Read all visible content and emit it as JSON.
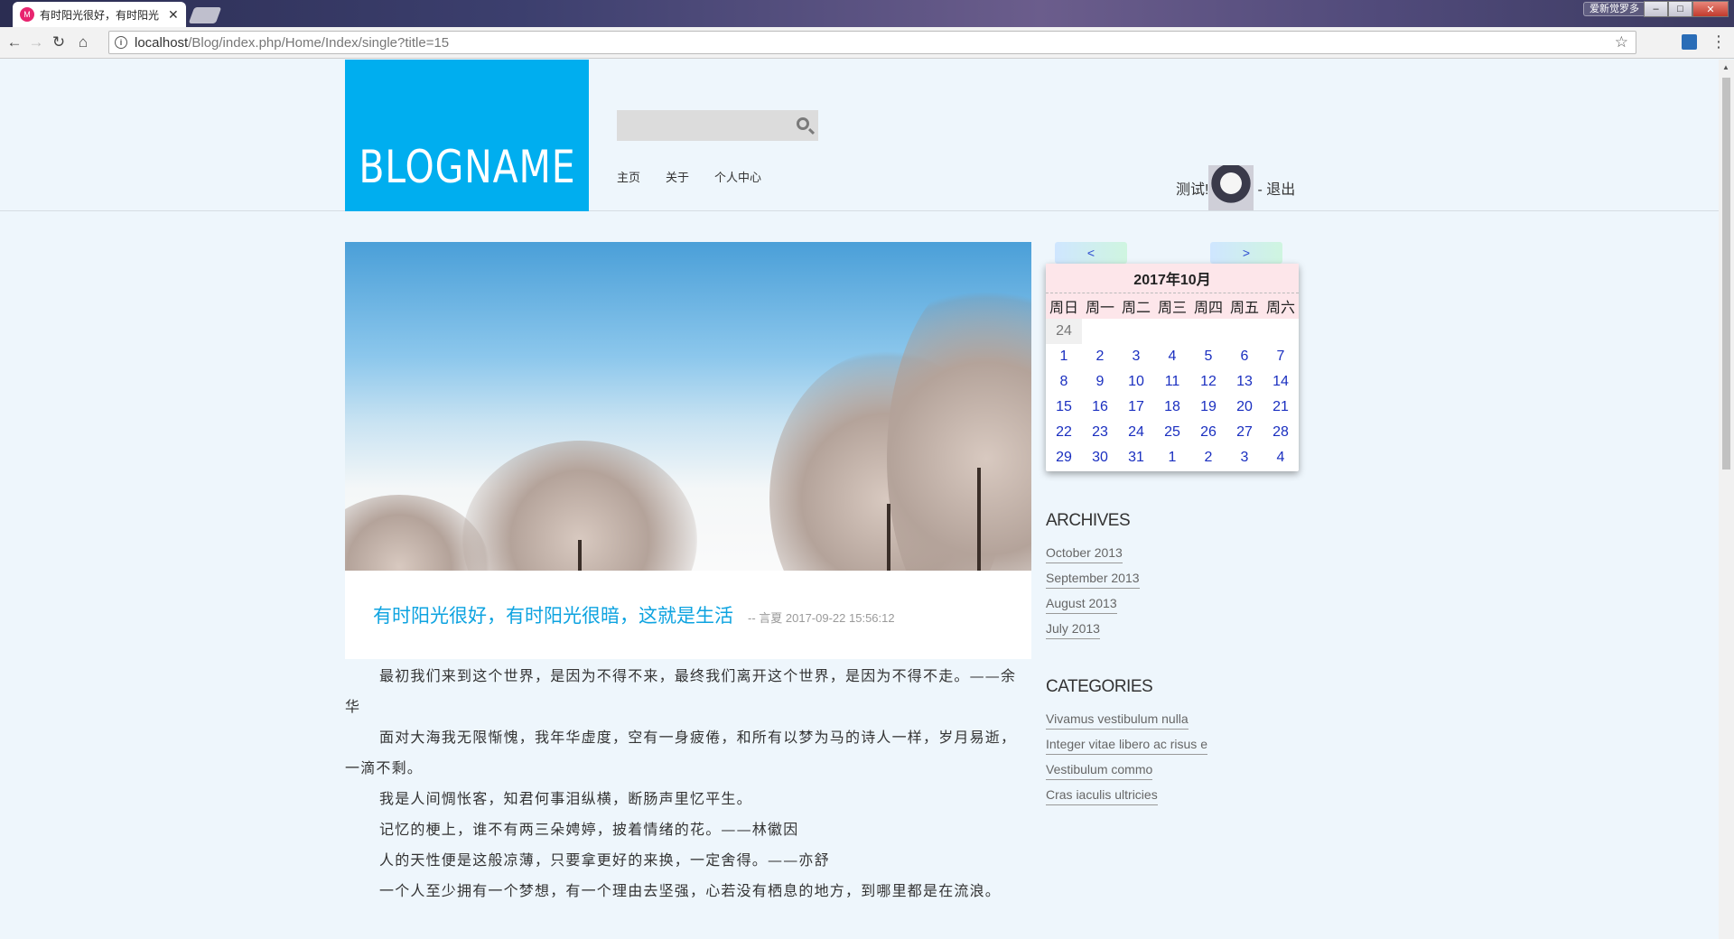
{
  "browser": {
    "tab_title": "有时阳光很好，有时阳光",
    "tab_close": "✕",
    "favicon_text": "M",
    "url_host": "localhost",
    "url_path": "/Blog/index.php/Home/Index/single?title=15",
    "window_user": "爱新觉罗多",
    "icons": [
      "back-icon",
      "forward-icon",
      "reload-icon",
      "home-icon",
      "info-icon",
      "star-icon",
      "menu-icon"
    ]
  },
  "site": {
    "logo": "BLOGNAME",
    "search_placeholder": "",
    "nav": [
      "主页",
      "关于",
      "个人中心"
    ],
    "greeting": "测试!",
    "logout": "- 退出"
  },
  "post": {
    "title": "有时阳光很好，有时阳光很暗，这就是生活",
    "meta": "-- 言夏 2017-09-22 15:56:12",
    "paragraphs": [
      "最初我们来到这个世界，是因为不得不来，最终我们离开这个世界，是因为不得不走。——余华",
      "面对大海我无限惭愧，我年华虚度，空有一身疲倦，和所有以梦为马的诗人一样，岁月易逝，一滴不剩。",
      "我是人间惆怅客，知君何事泪纵横，断肠声里忆平生。",
      "记忆的梗上，谁不有两三朵娉婷，披着情绪的花。——林徽因",
      "人的天性便是这般凉薄，只要拿更好的来换，一定舍得。——亦舒",
      "一个人至少拥有一个梦想，有一个理由去坚强，心若没有栖息的地方，到哪里都是在流浪。"
    ]
  },
  "calendar": {
    "prev": "<",
    "next": ">",
    "month_title": "2017年10月",
    "weekdays": [
      "周日",
      "周一",
      "周二",
      "周三",
      "周四",
      "周五",
      "周六"
    ],
    "first_row": [
      "24"
    ],
    "weeks": [
      [
        "1",
        "2",
        "3",
        "4",
        "5",
        "6",
        "7"
      ],
      [
        "8",
        "9",
        "10",
        "11",
        "12",
        "13",
        "14"
      ],
      [
        "15",
        "16",
        "17",
        "18",
        "19",
        "20",
        "21"
      ],
      [
        "22",
        "23",
        "24",
        "25",
        "26",
        "27",
        "28"
      ],
      [
        "29",
        "30",
        "31",
        "1",
        "2",
        "3",
        "4"
      ]
    ]
  },
  "sidebar": {
    "archives_title": "ARCHIVES",
    "archives": [
      "October 2013",
      "September 2013",
      "August 2013",
      "July 2013"
    ],
    "categories_title": "CATEGORIES",
    "categories": [
      "Vivamus vestibulum nulla",
      "Integer vitae libero ac risus e",
      "Vestibulum commo",
      "Cras iaculis ultricies"
    ]
  }
}
